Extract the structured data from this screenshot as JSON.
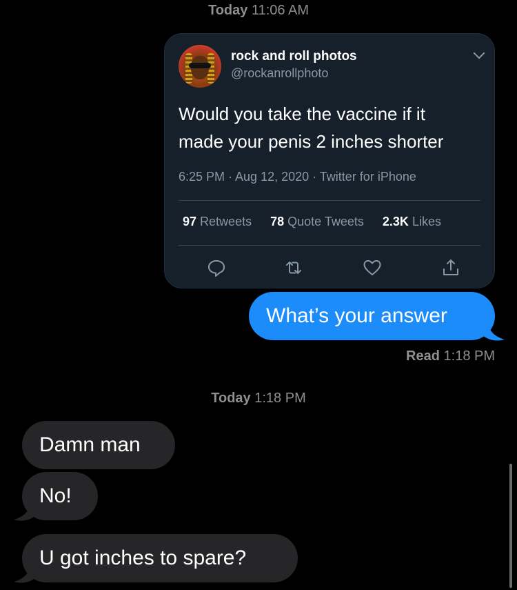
{
  "timestamps": {
    "first": {
      "day": "Today",
      "time": "11:06 AM"
    },
    "second": {
      "day": "Today",
      "time": "1:18 PM"
    }
  },
  "tweet": {
    "user_name": "rock and roll photos",
    "user_handle": "@rockanrollphoto",
    "text_line1": "Would you take the vaccine if it",
    "text_line2": "made your penis 2 inches shorter",
    "meta": "6:25 PM · Aug 12, 2020 · Twitter for iPhone",
    "stats": {
      "retweets_num": "97",
      "retweets_label": "Retweets",
      "quotes_num": "78",
      "quotes_label": "Quote Tweets",
      "likes_num": "2.3K",
      "likes_label": "Likes"
    },
    "icons": [
      "reply-icon",
      "retweet-icon",
      "like-icon",
      "share-icon",
      "chevron-down-icon"
    ]
  },
  "messages": {
    "sent": [
      {
        "text": "What’s your answer"
      }
    ],
    "read_receipt": {
      "label": "Read",
      "time": "1:18 PM"
    },
    "received": [
      {
        "text": "Damn man"
      },
      {
        "text": "No!"
      },
      {
        "text": "U got inches to spare?"
      }
    ]
  },
  "colors": {
    "background": "#000000",
    "sent_bubble": "#1b8cfa",
    "received_bubble": "#262628",
    "tweet_card": "#15202b",
    "secondary_text": "#8e8e93"
  }
}
